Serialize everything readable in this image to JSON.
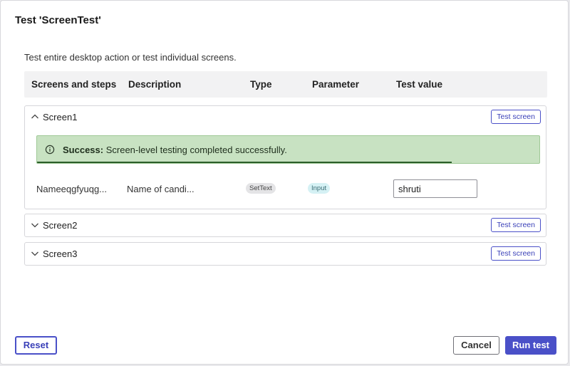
{
  "dialog": {
    "title": "Test 'ScreenTest'",
    "subtitle": "Test entire desktop action or test individual screens."
  },
  "table": {
    "headers": [
      "Screens and steps",
      "Description",
      "Type",
      "Parameter",
      "Test value"
    ]
  },
  "screens": [
    {
      "name": "Screen1",
      "expanded": true,
      "test_button": "Test screen",
      "alert": {
        "label": "Success:",
        "message": "Screen-level testing completed successfully."
      },
      "step": {
        "name": "Nameeqgfyuqg...",
        "description": "Name of candi...",
        "type": "SetText",
        "parameter": "Input",
        "test_value": "shruti"
      }
    },
    {
      "name": "Screen2",
      "expanded": false,
      "test_button": "Test screen"
    },
    {
      "name": "Screen3",
      "expanded": false,
      "test_button": "Test screen"
    }
  ],
  "footer": {
    "reset_label": "Reset",
    "cancel_label": "Cancel",
    "run_label": "Run test"
  },
  "colors": {
    "accent": "#4a50c8",
    "success_bg": "#c8e2c2",
    "success_bar": "#2b5e2a"
  }
}
